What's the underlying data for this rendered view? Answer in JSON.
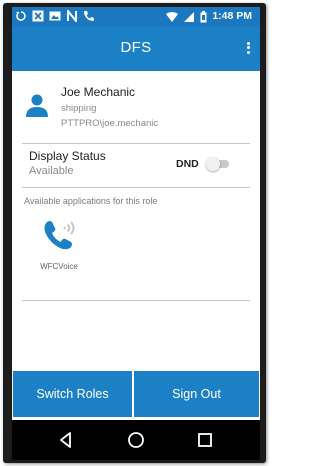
{
  "status_bar": {
    "time": "1:48 PM",
    "left_icons": [
      "sync-icon",
      "x-notification-icon",
      "media-icon",
      "n-notification-icon",
      "phone-icon"
    ],
    "right_icons": [
      "wifi-icon",
      "signal-icon",
      "battery-icon"
    ]
  },
  "app_bar": {
    "title": "DFS"
  },
  "profile": {
    "name": "Joe Mechanic",
    "role": "shipping",
    "user_id": "PTTPRO\\joe.mechanic"
  },
  "display_status": {
    "label": "Display Status",
    "value": "Available",
    "dnd_label": "DND",
    "dnd_enabled": false
  },
  "applications": {
    "heading": "Available applications for this role",
    "items": [
      {
        "label": "WFCVoice",
        "icon": "phone-wave-icon"
      }
    ]
  },
  "buttons": {
    "switch_roles": "Switch Roles",
    "sign_out": "Sign Out"
  },
  "colors": {
    "primary": "#1b80c5",
    "status_bar": "#1b77c0",
    "divider": "#c7c7c7",
    "secondary_text": "#8a8a8a"
  }
}
